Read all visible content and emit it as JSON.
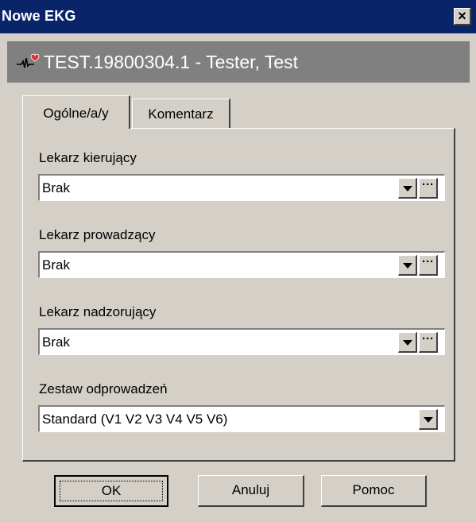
{
  "window": {
    "title": "Nowe EKG",
    "close_label": "×"
  },
  "patient": {
    "icon": "ecg-heart-icon",
    "label": "TEST.19800304.1 - Tester, Test"
  },
  "tabs": [
    {
      "label": "Ogólne/a/y",
      "active": true
    },
    {
      "label": "Komentarz",
      "active": false
    }
  ],
  "fields": [
    {
      "label": "Lekarz kierujący",
      "value": "Brak",
      "has_browse": true
    },
    {
      "label": "Lekarz prowadzący",
      "value": "Brak",
      "has_browse": true
    },
    {
      "label": "Lekarz nadzorujący",
      "value": "Brak",
      "has_browse": true
    },
    {
      "label": "Zestaw odprowadzeń",
      "value": "Standard (V1 V2 V3 V4 V5 V6)",
      "has_browse": false
    }
  ],
  "browse_label": "···",
  "buttons": {
    "ok": "OK",
    "cancel": "Anuluj",
    "help": "Pomoc"
  },
  "colors": {
    "titlebar": "#0a246a",
    "face": "#d4d0c8",
    "patient_bar": "#808080",
    "heart": "#e0303a"
  }
}
